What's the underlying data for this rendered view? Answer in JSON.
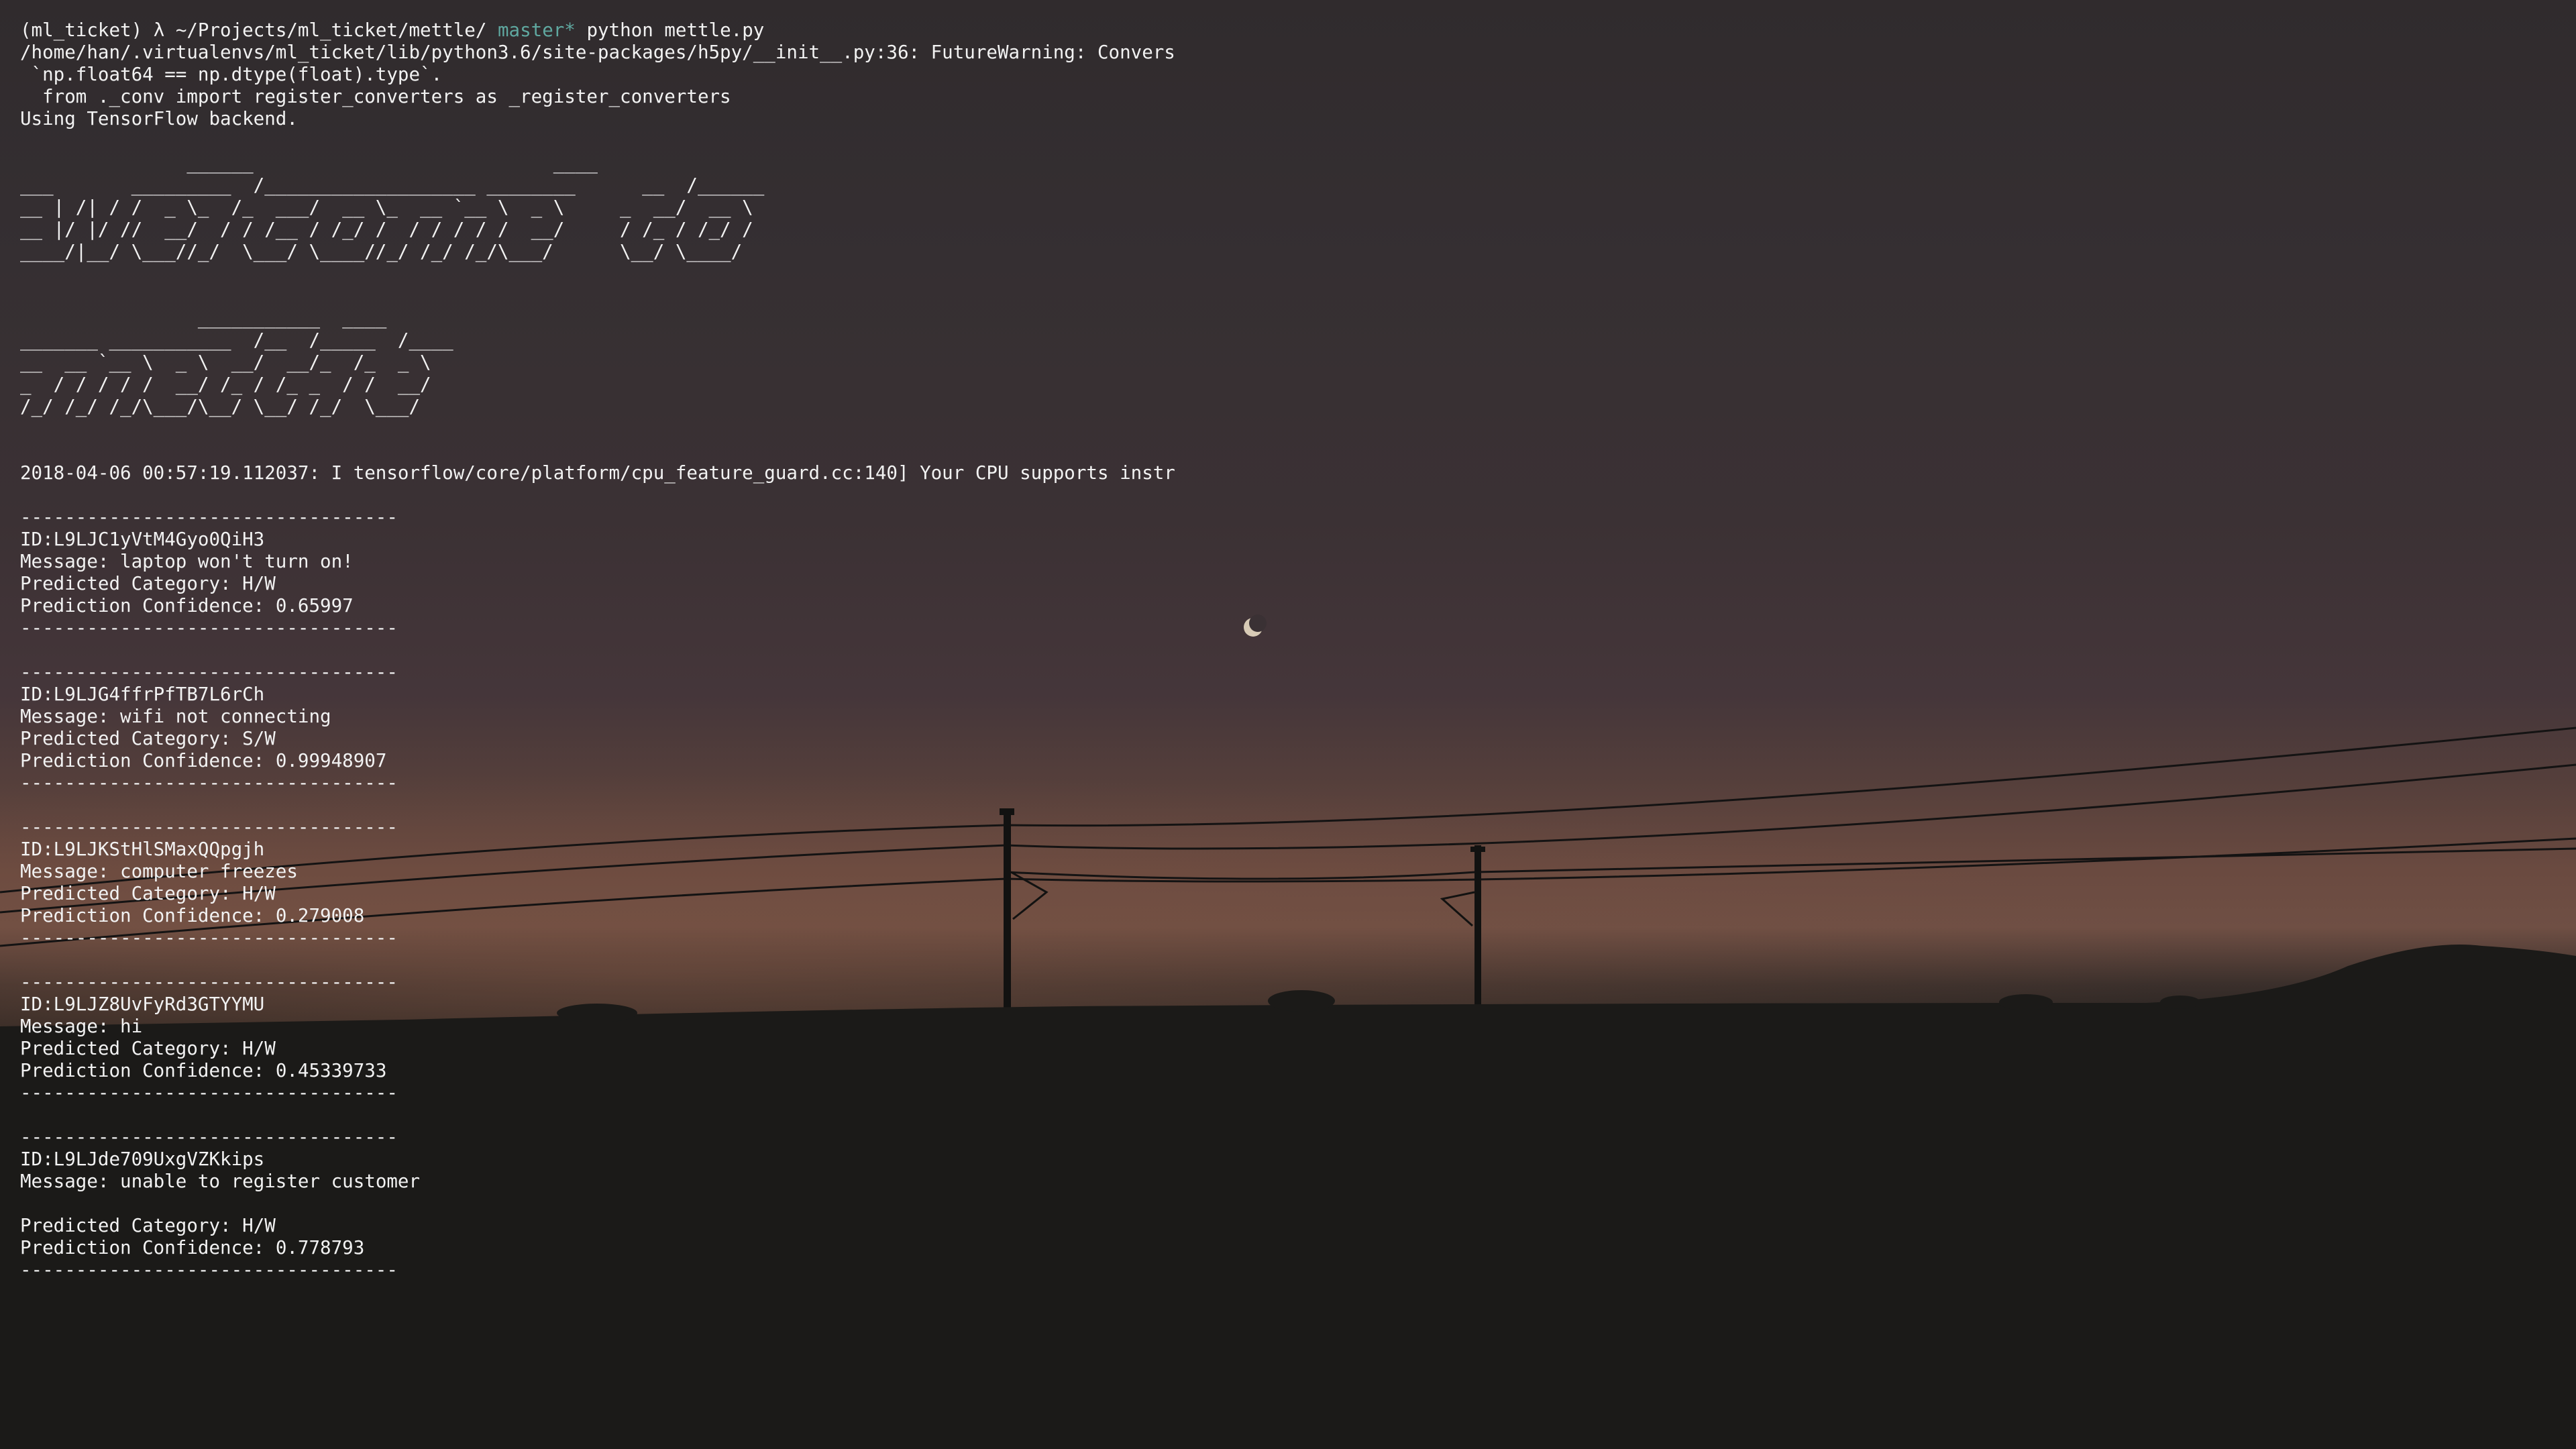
{
  "terminal": {
    "prompt": {
      "env": "(ml_ticket)",
      "symbol": "λ",
      "path": "~/Projects/ml_ticket/mettle/",
      "branch": "master*",
      "command": "python mettle.py"
    },
    "warnings": [
      "/home/han/.virtualenvs/ml_ticket/lib/python3.6/site-packages/h5py/__init__.py:36: FutureWarning: Convers",
      " `np.float64 == np.dtype(float).type`.",
      "  from ._conv import register_converters as _register_converters",
      "Using TensorFlow backend."
    ],
    "banner_welcome": [
      "               ______                           ____",
      "___       _________  /___________________ ________      __  /______",
      "__ | /| / /  _ \\_  /_  ___/  __ \\_  __ `__ \\  _ \\     _  __/  __ \\",
      "__ |/ |/ //  __/  / / /__ / /_/ /  / / / / /  __/     / /_ / /_/ /",
      "____/|__/ \\___//_/  \\___/ \\____//_/ /_/ /_/\\___/      \\__/ \\____/"
    ],
    "banner_mettle": [
      "                ___________  ____",
      "_______ ___________  /__  /_____  /____",
      "__  __ `__ \\  _ \\  __/  __/_  /_  _ \\",
      "_  / / / / /  __/ /_ / /_ _  / /  __/",
      "/_/ /_/ /_/\\___/\\__/ \\__/ /_/  \\___/"
    ],
    "tf_log": "2018-04-06 00:57:19.112037: I tensorflow/core/platform/cpu_feature_guard.cc:140] Your CPU supports instr",
    "separator": "----------------------------------",
    "labels": {
      "message": "Message: ",
      "category": "Predicted Category: ",
      "confidence": "Prediction Confidence: "
    },
    "tickets": [
      {
        "id": "ID:L9LJC1yVtM4Gyo0QiH3",
        "message": "laptop won't turn on!",
        "category": "H/W",
        "confidence": "0.65997"
      },
      {
        "id": "ID:L9LJG4ffrPfTB7L6rCh",
        "message": "wifi not connecting",
        "category": "S/W",
        "confidence": "0.99948907"
      },
      {
        "id": "ID:L9LJKStHlSMaxQQpgjh",
        "message": "computer freezes",
        "category": "H/W",
        "confidence": "0.279008"
      },
      {
        "id": "ID:L9LJZ8UvFyRd3GTYYMU",
        "message": "hi",
        "category": "H/W",
        "confidence": "0.45339733"
      },
      {
        "id": "ID:L9LJde709UxgVZKkips",
        "message": "unable to register customer",
        "category": "H/W",
        "confidence": "0.778793",
        "blank_after_message": true
      }
    ]
  },
  "colors": {
    "text": "#f2f2f2",
    "branch": "#5fa8a0",
    "background": "#191816"
  }
}
